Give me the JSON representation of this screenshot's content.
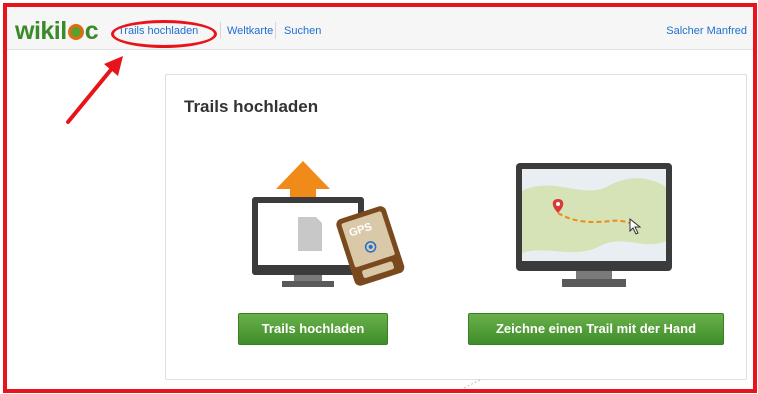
{
  "header": {
    "logo": {
      "pre": "wikil",
      "post": "c"
    },
    "nav": [
      {
        "label": "Trails hochladen",
        "highlighted": true
      },
      {
        "label": "Weltkarte"
      },
      {
        "label": "Suchen"
      }
    ],
    "user": "Salcher Manfred"
  },
  "main": {
    "title": "Trails hochladen",
    "upload_button": "Trails hochladen",
    "draw_button": "Zeichne einen Trail mit der Hand",
    "gps_label": "GPS"
  },
  "colors": {
    "annotation_red": "#e8141b",
    "link_blue": "#1f6fd1",
    "button_green": "#4f9d34",
    "arrow_orange": "#f08a18"
  }
}
